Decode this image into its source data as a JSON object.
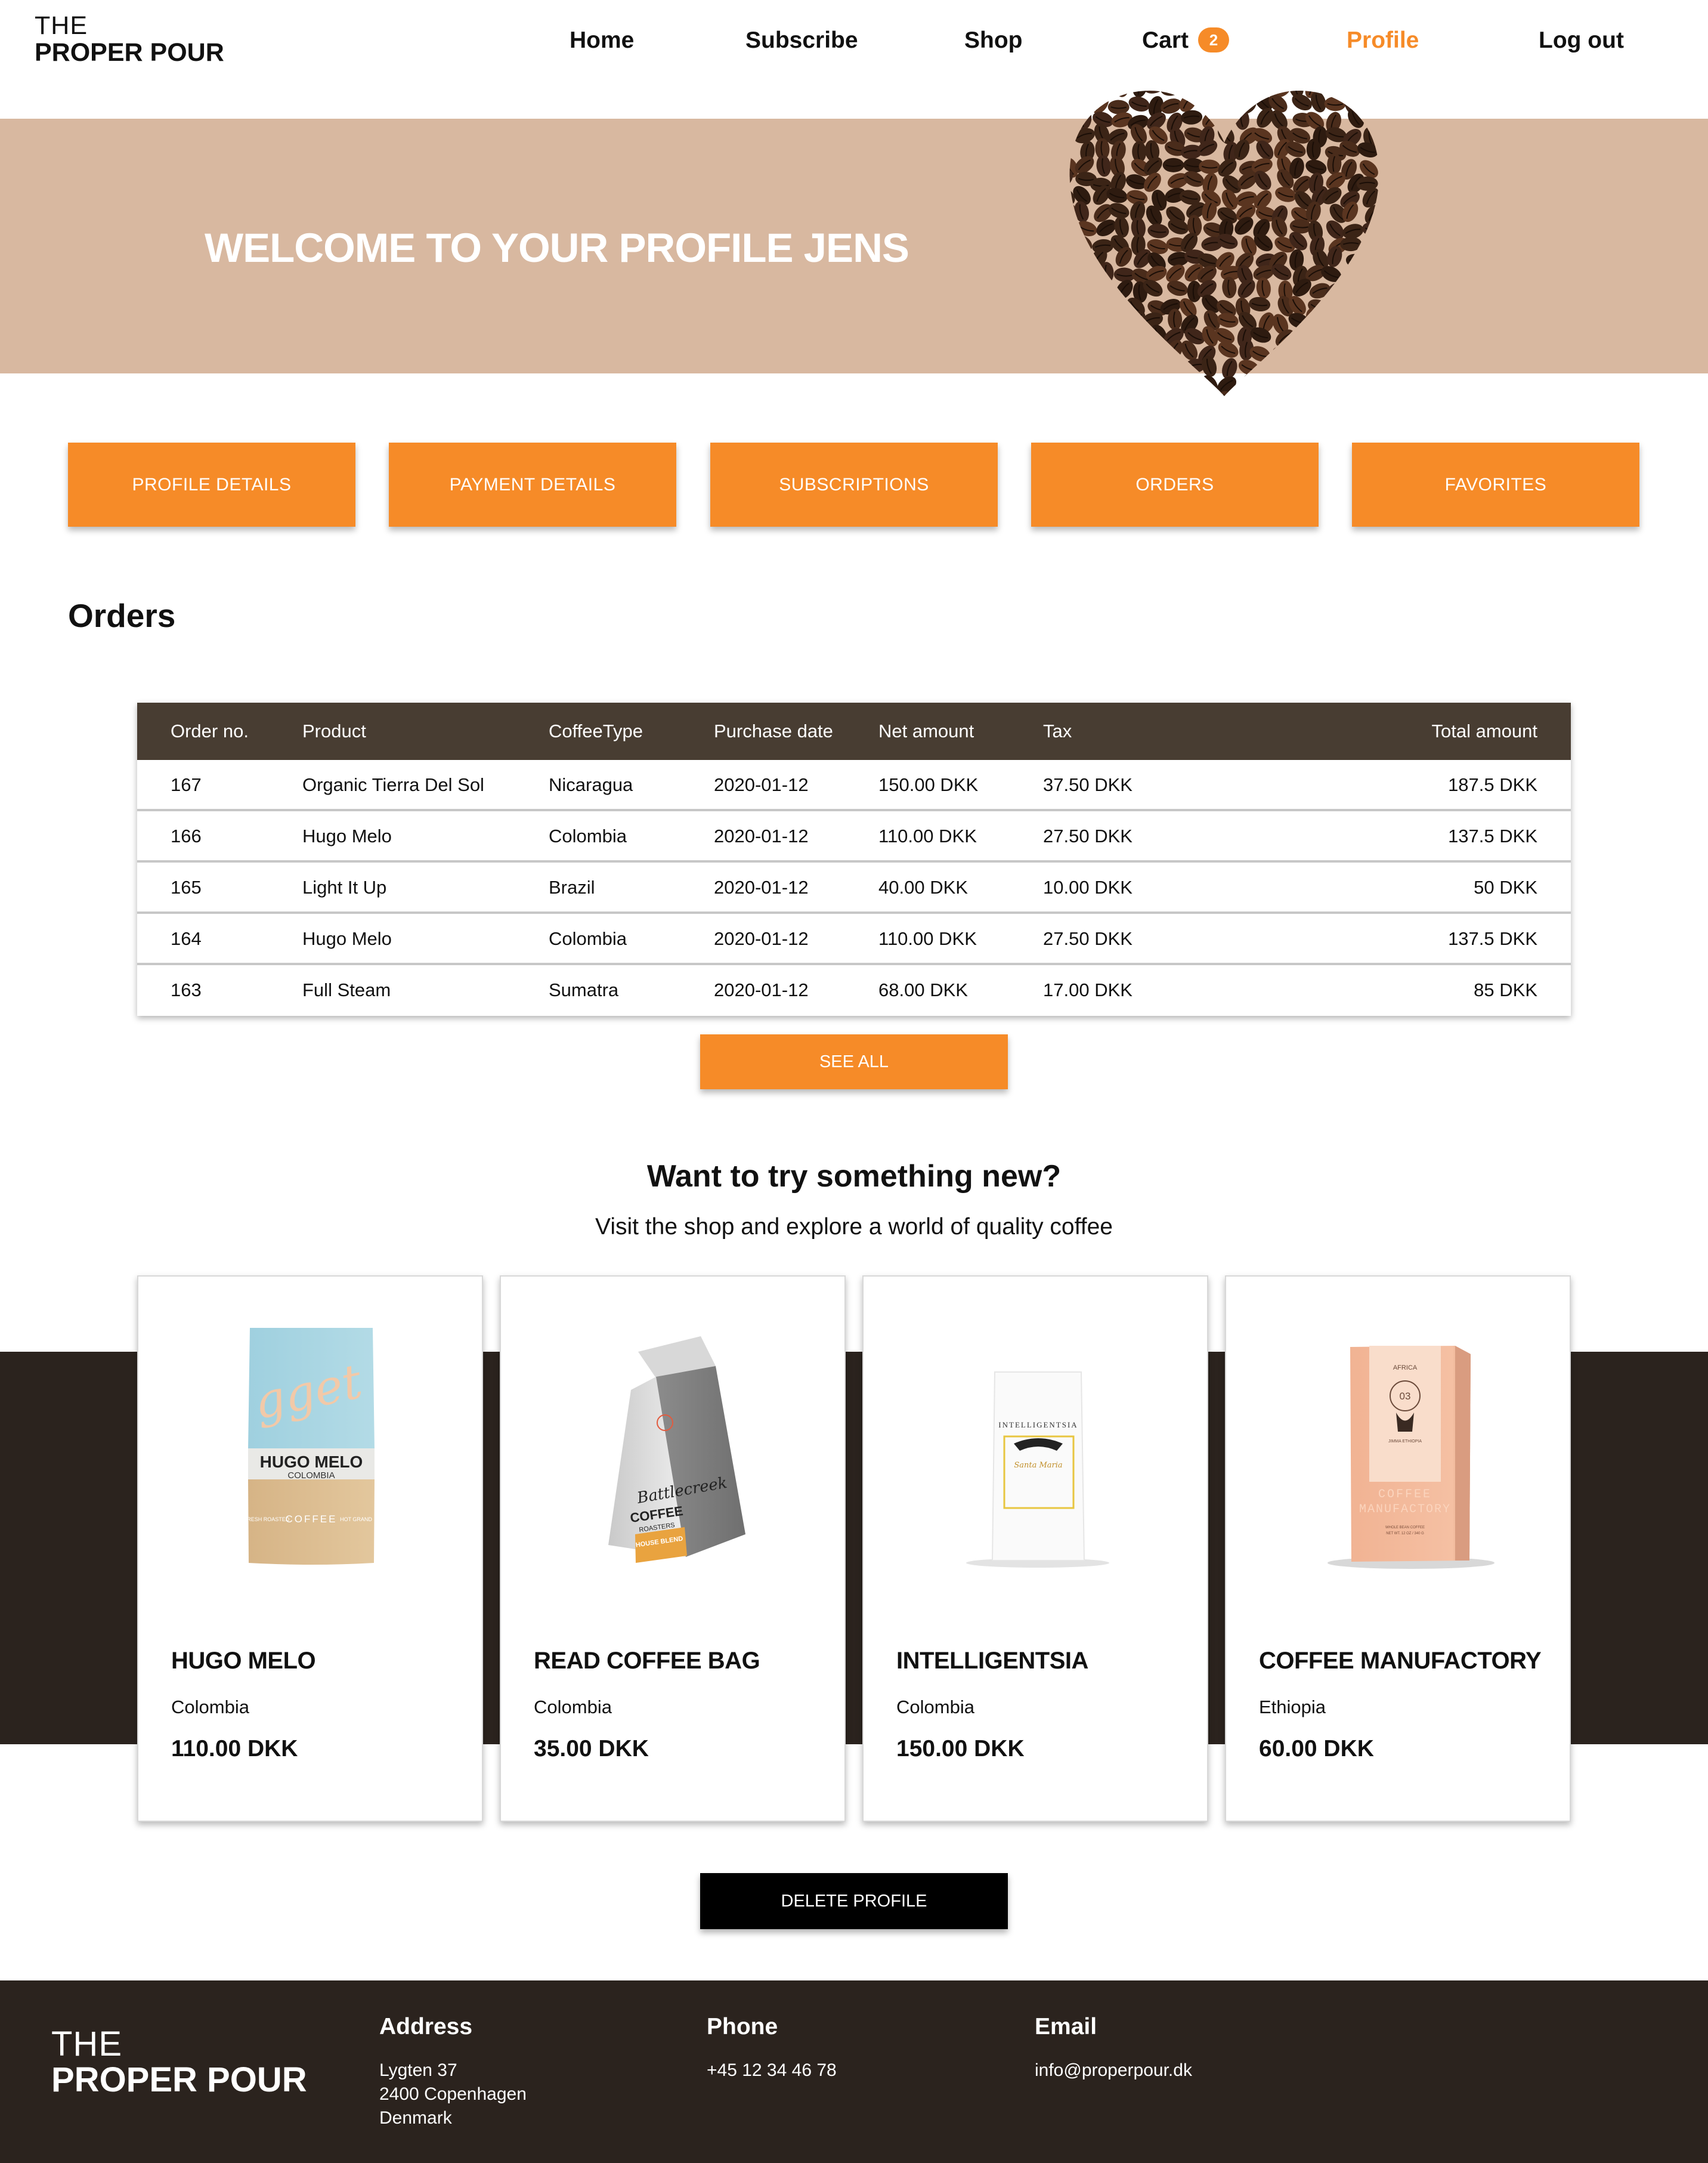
{
  "brand": {
    "line1": "THE",
    "line2": "PROPER POUR"
  },
  "nav": {
    "home": "Home",
    "subscribe": "Subscribe",
    "shop": "Shop",
    "cart": "Cart",
    "cart_count": "2",
    "profile": "Profile",
    "logout": "Log out"
  },
  "banner": {
    "title": "WELCOME TO YOUR PROFILE JENS",
    "image_icon": "coffee-bean-heart"
  },
  "tabs": [
    "PROFILE DETAILS",
    "PAYMENT DETAILS",
    "SUBSCRIPTIONS",
    "ORDERS",
    "FAVORITES"
  ],
  "orders": {
    "heading": "Orders",
    "columns": [
      "Order no.",
      "Product",
      "CoffeeType",
      "Purchase date",
      "Net amount",
      "Tax",
      "Total amount"
    ],
    "rows": [
      [
        "167",
        "Organic Tierra Del Sol",
        "Nicaragua",
        "2020-01-12",
        "150.00 DKK",
        "37.50 DKK",
        "187.5 DKK"
      ],
      [
        "166",
        "Hugo Melo",
        "Colombia",
        "2020-01-12",
        "110.00 DKK",
        "27.50 DKK",
        "137.5 DKK"
      ],
      [
        "165",
        "Light It Up",
        "Brazil",
        "2020-01-12",
        "40.00 DKK",
        "10.00 DKK",
        "50 DKK"
      ],
      [
        "164",
        "Hugo Melo",
        "Colombia",
        "2020-01-12",
        "110.00 DKK",
        "27.50 DKK",
        "137.5 DKK"
      ],
      [
        "163",
        "Full Steam",
        "Sumatra",
        "2020-01-12",
        "68.00 DKK",
        "17.00 DKK",
        "85 DKK"
      ]
    ],
    "see_all": "SEE ALL"
  },
  "promo": {
    "title": "Want to try something new?",
    "subtitle": "Visit the shop and explore a world of quality coffee"
  },
  "products": [
    {
      "name": "HUGO MELO",
      "origin": "Colombia",
      "price": "110.00 DKK",
      "bag_text": {
        "script": "gget",
        "brand": "HUGO MELO",
        "sub": "COLOMBIA",
        "left": "FRESH ROASTED",
        "mid": "COFFEE",
        "right": "HOT GRAND"
      }
    },
    {
      "name": "READ COFFEE BAG",
      "origin": "Colombia",
      "price": "35.00 DKK",
      "bag_text": {
        "script": "Battlecreek",
        "brand": "COFFEE",
        "sub": "ROASTERS",
        "label": "HOUSE BLEND"
      }
    },
    {
      "name": "INTELLIGENTSIA",
      "origin": "Colombia",
      "price": "150.00 DKK",
      "bag_text": {
        "brand": "INTELLIGENTSIA",
        "script": "Santa Maria"
      }
    },
    {
      "name": "COFFEE MANUFACTORY",
      "origin": "Ethiopia",
      "price": "60.00 DKK",
      "bag_text": {
        "region": "AFRICA",
        "number": "03",
        "sub": "JIMMA ETHIOPIA",
        "brand1": "COFFEE",
        "brand2": "MANUFACTORY",
        "fine": "WHOLE BEAN COFFEE",
        "weight": "NET WT. 12 OZ / 340 G"
      }
    }
  ],
  "delete_profile": "DELETE PROFILE",
  "footer": {
    "logo1": "THE",
    "logo2": "PROPER POUR",
    "address_heading": "Address",
    "address_lines": [
      "Lygten 37",
      "2400 Copenhagen",
      "Denmark"
    ],
    "phone_heading": "Phone",
    "phone": "+45 12 34 46 78",
    "email_heading": "Email",
    "email": "info@properpour.dk"
  },
  "colors": {
    "accent": "#f68b28",
    "banner": "#d8b8a0",
    "table_header": "#483d32",
    "dark": "#2b231e"
  }
}
